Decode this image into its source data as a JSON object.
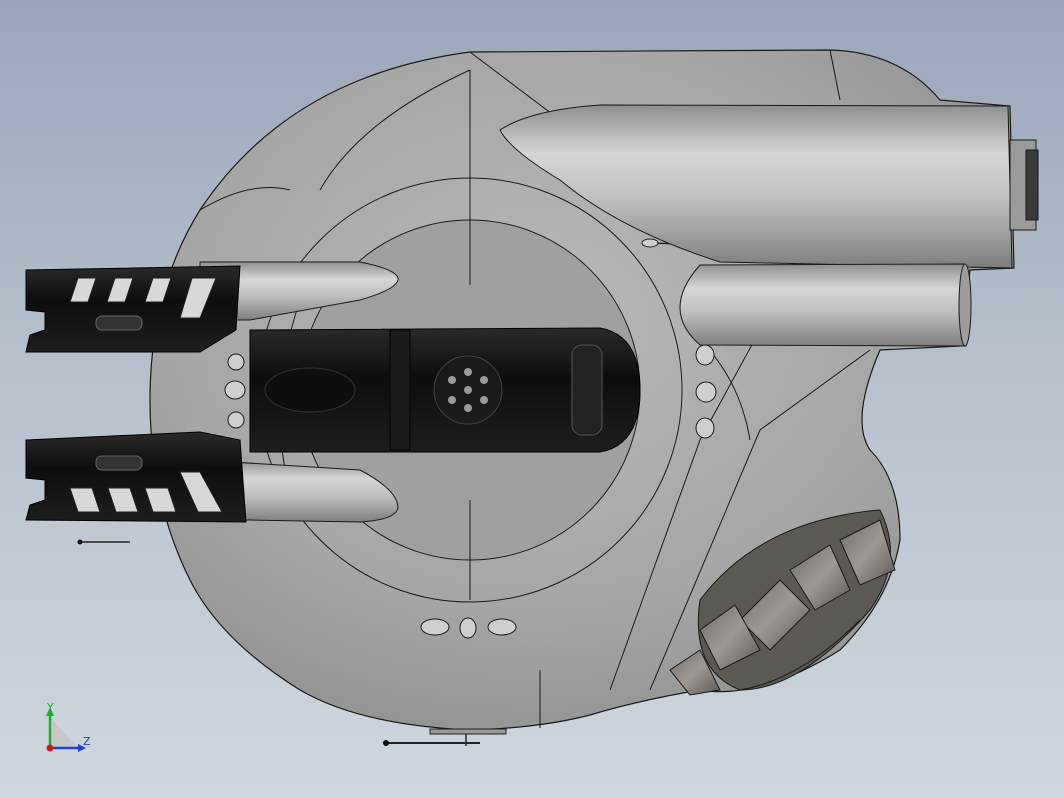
{
  "viewport": {
    "background_top": "#9aa7b9",
    "background_bottom": "#cfd6de"
  },
  "model": {
    "body_color": "#a9a9a9",
    "barrel_color": "#b9b9b9",
    "dark_part_color": "#161616",
    "edge_color": "#1a1a1a"
  },
  "triad": {
    "y_label": "Y",
    "z_label": "Z",
    "y_color": "#1fae2a",
    "z_color": "#1f3fd6",
    "x_color": "#d11a1a"
  }
}
